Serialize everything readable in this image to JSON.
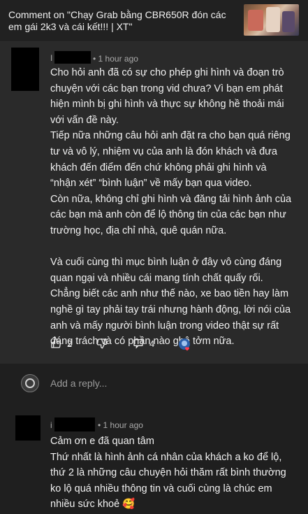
{
  "header": {
    "title": "Comment on \"Chạy Grab bằng CBR650R đón các em gái 2k3 và cái kết!!! | XT\""
  },
  "comment": {
    "time": "1 hour ago",
    "paragraph1": "Cho hỏi anh đã có sự cho phép ghi hình và đoạn trò chuyện với các bạn trong vid chưa? Vì bạn em phát hiện mình bị ghi hình và thực sự không hề thoải mái với vấn đề này.",
    "paragraph2": "Tiếp nữa những câu hỏi anh đặt ra cho bạn quá riêng tư và vô lý, nhiệm vụ của anh là đón khách và đưa khách đến điểm đến chứ không phải ghi hình và “nhận xét” “bình luận” về mấy bạn qua video.",
    "paragraph3": "Còn nữa, không chỉ ghi hình và đăng tải hình ảnh của các bạn mà anh còn để lộ thông tin của các bạn như trường học, địa chỉ nhà, quê quán nữa.",
    "paragraph4": "Và cuối cùng thì mục bình luận ở đây vô cùng đáng quan ngại và nhiều cái mang tính chất quấy rối. Chẳng biết các anh như thế nào, xe bao tiền hay làm nghề gì tay phải tay trái nhưng hành động, lời nói của anh và mấy người bình luận trong video thật sự rất đáng trách và có phần nào ghê tởm nữa.",
    "like_count": "2",
    "reply_count": "4"
  },
  "reply_bar": {
    "placeholder": "Add a reply..."
  },
  "reply": {
    "time": "1 hour ago",
    "line1": "Cảm ơn e đã quan tâm",
    "body": "Thứ nhất là hình ảnh cá nhân của khách a ko để lộ, thứ 2 là những câu chuyện hỏi thăm rất bình thường ko lộ quá nhiều thông tin và cuối cùng là chúc em nhiều sức khoẻ 🥰"
  },
  "icons": {
    "like": "thumbs-up-icon",
    "dislike": "thumbs-down-icon",
    "reply": "reply-icon",
    "creator_heart": "creator-avatar-icon"
  }
}
